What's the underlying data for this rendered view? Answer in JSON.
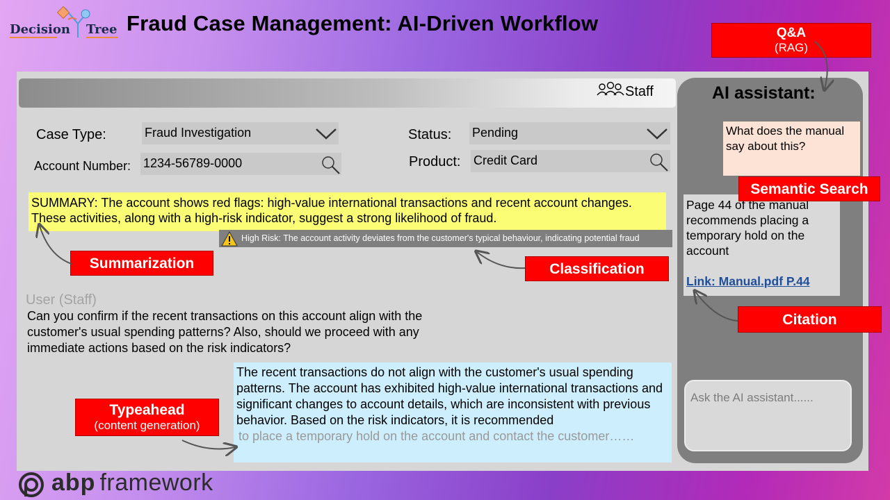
{
  "header": {
    "logo_word_1": "Decision",
    "logo_word_2": "Tree",
    "title": "Fraud Case Management: AI-Driven Workflow"
  },
  "topbar": {
    "staff_label": "Staff",
    "staff_icon": "users-icon"
  },
  "form": {
    "case_type_label": "Case Type:",
    "case_type_value": "Fraud Investigation",
    "account_number_label": "Account Number:",
    "account_number_value": "1234-56789-0000",
    "status_label": "Status:",
    "status_value": "Pending",
    "product_label": "Product:",
    "product_value": "Credit Card"
  },
  "summary": {
    "text": "SUMMARY: The account shows red flags: high-value international transactions and recent account changes. These activities, along with a high-risk indicator, suggest a strong likelihood of fraud."
  },
  "risk": {
    "text": "High Risk: The account activity deviates from the customer's typical behaviour, indicating potential fraud",
    "icon": "warning-icon"
  },
  "conversation": {
    "user_label": "User (Staff)",
    "user_question": "Can you confirm if the recent transactions on this account align with the customer's usual spending patterns? Also, should we proceed with any immediate actions based on the risk indicators?",
    "answer_text": "The recent transactions do not align with the customer's usual spending patterns. The account has exhibited high-value international transactions and significant changes to account details, which are inconsistent with previous behavior. Based on the risk indicators, it is recommended",
    "answer_generated": "to place a temporary hold on the account and contact the customer……"
  },
  "ai_assistant": {
    "title": "AI assistant:",
    "question": "What does the manual say about this?",
    "answer": "Page 44 of the manual recommends placing a temporary hold on the account",
    "link": "Link: Manual.pdf P.44",
    "input_placeholder": "Ask the AI assistant......"
  },
  "callouts": {
    "qa": "Q&A",
    "qa_sub": "(RAG)",
    "summarization": "Summarization",
    "classification": "Classification",
    "semantic_search": "Semantic Search",
    "citation": "Citation",
    "typeahead": "Typeahead",
    "typeahead_sub": "(content generation)"
  },
  "footer": {
    "brand_1": "abp",
    "brand_2": "framework"
  },
  "colors": {
    "callout_red": "#ff0000",
    "summary_yellow": "#fbfd74",
    "answer_blue": "#cdeefd",
    "question_peach": "#fde3d6",
    "link_blue": "#1f4e9a"
  }
}
